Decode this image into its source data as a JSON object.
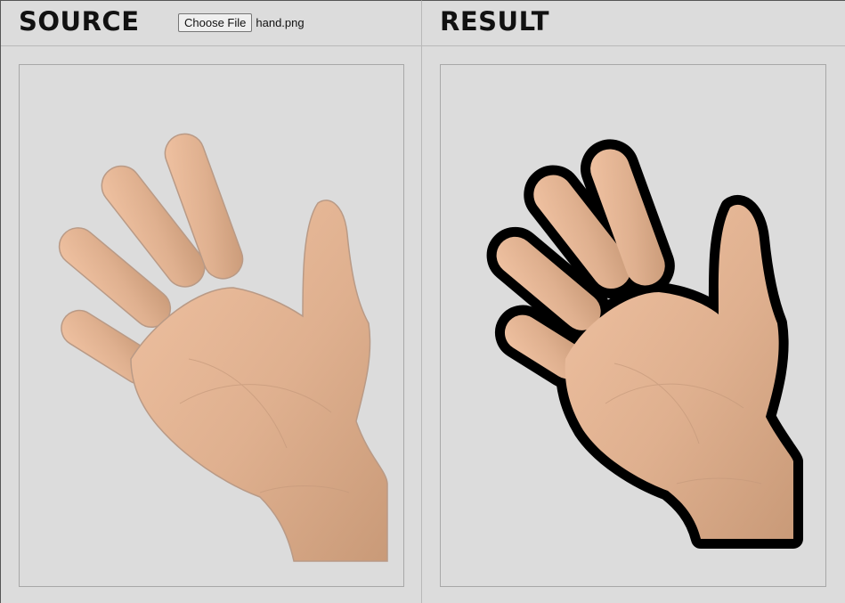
{
  "source": {
    "title": "SOURCE",
    "file_button_label": "Choose File",
    "file_name": "hand.png"
  },
  "result": {
    "title": "RESULT"
  },
  "colors": {
    "background": "#dcdcdc",
    "skin": "#e1b594",
    "outline": "#000000"
  }
}
